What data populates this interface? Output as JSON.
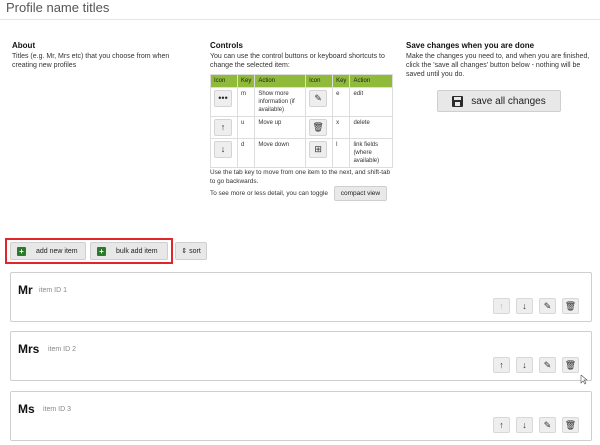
{
  "page": {
    "title": "Profile name titles"
  },
  "about": {
    "heading": "About",
    "text": "Titles (e.g. Mr, Mrs etc) that you choose from when creating new profiles"
  },
  "controls": {
    "heading": "Controls",
    "intro": "You can use the control buttons or keyboard shortcuts to change the selected item:",
    "headers": [
      "Icon",
      "Key",
      "Action",
      "Icon",
      "Key",
      "Action"
    ],
    "rows": [
      {
        "left_icon": "more-icon",
        "left_key": "m",
        "left_action": "Show more information (if available)",
        "right_icon": "edit-icon",
        "right_key": "e",
        "right_action": "edit"
      },
      {
        "left_icon": "move-up-icon",
        "left_key": "u",
        "left_action": "Move up",
        "right_icon": "trash-icon",
        "right_key": "x",
        "right_action": "delete"
      },
      {
        "left_icon": "move-down-icon",
        "left_key": "d",
        "left_action": "Move down",
        "right_icon": "link-fields-icon",
        "right_key": "l",
        "right_action": "link fields (where available)"
      }
    ],
    "tab_note": "Use the tab key to move from one item to the next, and shift-tab to go backwards.",
    "toggle_note": "To see more or less detail, you can toggle",
    "compact_label": "compact view"
  },
  "save": {
    "heading": "Save changes when you are done",
    "text": "Make the changes you need to, and when you are finished, click the 'save all changes' button below - nothing will be saved until you do.",
    "button_label": "save all changes"
  },
  "toolbar": {
    "add_new_label": "add new item",
    "bulk_add_label": "bulk add item",
    "sort_label": "sort"
  },
  "items": [
    {
      "name": "Mr",
      "id_label": "item ID 1"
    },
    {
      "name": "Mrs",
      "id_label": "item ID 2"
    },
    {
      "name": "Ms",
      "id_label": "item ID 3"
    }
  ],
  "colors": {
    "table_header": "#8fba3a",
    "highlight": "#e0262a",
    "add_icon": "#2b7a2b"
  }
}
